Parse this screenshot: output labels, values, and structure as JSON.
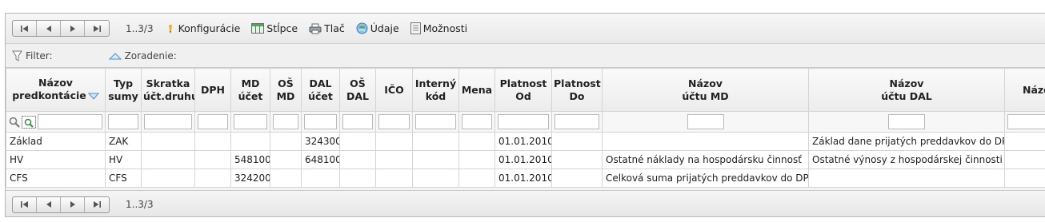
{
  "pager": {
    "first_label": "|◀",
    "prev_label": "◀",
    "next_label": "▶",
    "last_label": "▶|",
    "range": "1..3/3"
  },
  "toolbar": {
    "configuration": "Konfigurácie",
    "columns": "Stĺpce",
    "print": "Tlač",
    "data": "Údaje",
    "options": "Možnosti"
  },
  "filterbar": {
    "filter_label": "Filter:",
    "sort_label": "Zoradenie:"
  },
  "table": {
    "headers": [
      "Názov predkontácie",
      "Typ sumy",
      "Skratka účt.druhu",
      "DPH",
      "MD účet",
      "OŠ MD",
      "DAL účet",
      "OŠ DAL",
      "IČO",
      "Interný kód",
      "Mena",
      "Platnost Od",
      "Platnost Do",
      "Názov účtu MD",
      "Názov účtu DAL",
      "Názov firmy"
    ],
    "rows": [
      [
        "Základ",
        "ZAK",
        "",
        "",
        "",
        "",
        "324300",
        "",
        "",
        "",
        "",
        "01.01.2010",
        "",
        "",
        "Základ dane prijatých preddavkov do DPH",
        ""
      ],
      [
        "HV",
        "HV",
        "",
        "",
        "548100",
        "",
        "648100",
        "",
        "",
        "",
        "",
        "01.01.2010",
        "",
        "Ostatné náklady na hospodársku činnosť",
        "Ostatné výnosy z hospodárskej činnosti",
        ""
      ],
      [
        "CFS",
        "CFS",
        "",
        "",
        "324200",
        "",
        "",
        "",
        "",
        "",
        "",
        "01.01.2010",
        "",
        "Celková suma prijatých preddavkov do DPH",
        "",
        ""
      ]
    ]
  },
  "bottom_pager": {
    "range": "1..3/3"
  },
  "colors": {
    "border": "#d4d4d4",
    "toolbar_bg": "#ececec",
    "header_bg": "#f2f2f2",
    "sort_arrow": "#5b9bd5"
  },
  "icons": [
    "first-page-icon",
    "prev-page-icon",
    "next-page-icon",
    "last-page-icon",
    "pencil-icon",
    "columns-icon",
    "printer-icon",
    "data-icon",
    "options-icon",
    "funnel-icon",
    "sort-icon",
    "magnifier-icon",
    "clear-filter-icon"
  ]
}
